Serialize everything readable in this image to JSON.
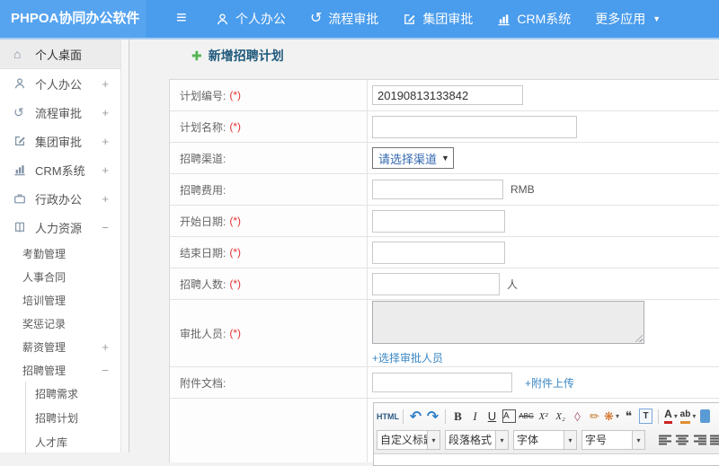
{
  "colors": {
    "navbar": "#4a9cec",
    "brand_bg": "#56a4f0",
    "link": "#3a87c4",
    "title": "#205a7c",
    "required": "#e63333",
    "add_icon": "#54b554",
    "select_text": "#3468b0"
  },
  "icons": {
    "hamburger": "≡",
    "caret_down": "▼",
    "caret_small": "▾",
    "home": "⌂",
    "process": "↺",
    "add": "✚"
  },
  "navbar": {
    "brand": "PHPOA协同办公软件",
    "items": [
      {
        "label": "个人办公"
      },
      {
        "label": "流程审批"
      },
      {
        "label": "集团审批"
      },
      {
        "label": "CRM系统"
      },
      {
        "label": "更多应用"
      }
    ]
  },
  "sidebar": {
    "items": [
      {
        "label": "个人桌面",
        "toggle": ""
      },
      {
        "label": "个人办公",
        "toggle": "+"
      },
      {
        "label": "流程审批",
        "toggle": "+"
      },
      {
        "label": "集团审批",
        "toggle": "+"
      },
      {
        "label": "CRM系统",
        "toggle": "+"
      },
      {
        "label": "行政办公",
        "toggle": "+"
      },
      {
        "label": "人力资源",
        "toggle": "−"
      },
      {
        "label": "考勤管理",
        "toggle": ""
      },
      {
        "label": "人事合同",
        "toggle": ""
      },
      {
        "label": "培训管理",
        "toggle": ""
      },
      {
        "label": "奖惩记录",
        "toggle": ""
      },
      {
        "label": "薪资管理",
        "toggle": "+"
      },
      {
        "label": "招聘管理",
        "toggle": "−"
      },
      {
        "label": "招聘需求",
        "toggle": ""
      },
      {
        "label": "招聘计划",
        "toggle": ""
      },
      {
        "label": "人才库",
        "toggle": ""
      }
    ]
  },
  "page": {
    "title": "新增招聘计划"
  },
  "form": {
    "plan_no": {
      "label": "计划编号:",
      "required": "(*)",
      "value": "20190813133842"
    },
    "plan_name": {
      "label": "计划名称:",
      "required": "(*)"
    },
    "channel": {
      "label": "招聘渠道:",
      "select": "请选择渠道"
    },
    "cost": {
      "label": "招聘费用:",
      "unit": "RMB"
    },
    "start_date": {
      "label": "开始日期:",
      "required": "(*)"
    },
    "end_date": {
      "label": "结束日期:",
      "required": "(*)"
    },
    "head_count": {
      "label": "招聘人数:",
      "required": "(*)",
      "unit": "人"
    },
    "approver": {
      "label": "审批人员:",
      "required": "(*)",
      "link": "+选择审批人员"
    },
    "attachment": {
      "label": "附件文档:",
      "link": "+附件上传"
    }
  },
  "editor": {
    "html_label": "HTML",
    "buttons": {
      "undo": "↶",
      "redo": "↷",
      "bold": "B",
      "italic": "I",
      "underline": "U",
      "font_box": "A",
      "strike": "ABC",
      "sup": "X²",
      "sub": "X₂",
      "eraser": "◊",
      "brush": "✏",
      "autoformat": "❋",
      "quote": "❝",
      "paste_text": "T",
      "forecolor": "A",
      "backcolor": "ab",
      "caret": "▾",
      "link": "∞"
    },
    "dropdowns": {
      "custom_title": "自定义标题",
      "paragraph": "段落格式",
      "font": "字体",
      "size": "字号"
    }
  }
}
